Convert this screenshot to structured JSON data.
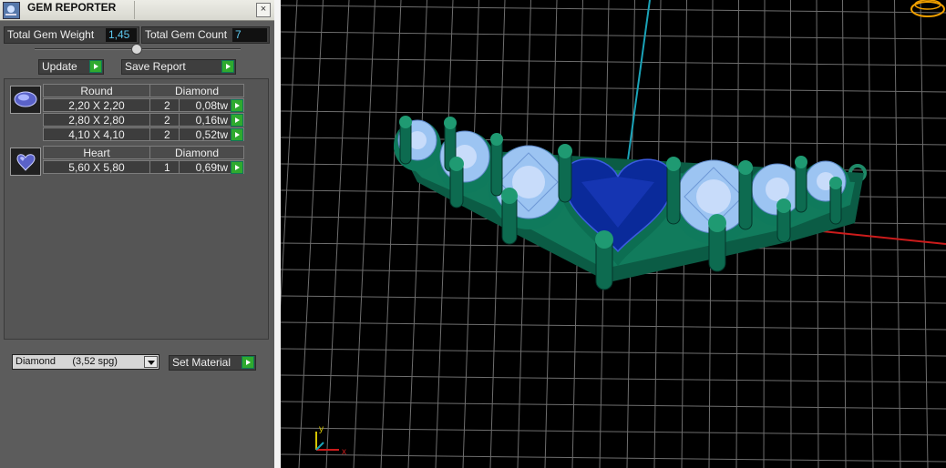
{
  "window": {
    "title": "GEM REPORTER",
    "close": "×"
  },
  "stats": {
    "total_weight_label": "Total Gem Weight",
    "total_weight_value": "1,45",
    "total_count_label": "Total Gem Count",
    "total_count_value": "7"
  },
  "toolbar": {
    "update_label": "Update",
    "save_report_label": "Save Report"
  },
  "gem_groups": [
    {
      "shape": "Round",
      "material": "Diamond",
      "thumb_icon": "round-gem-icon",
      "rows": [
        {
          "size": "2,20 X 2,20",
          "qty": "2",
          "weight": "0,08tw"
        },
        {
          "size": "2,80 X 2,80",
          "qty": "2",
          "weight": "0,16tw"
        },
        {
          "size": "4,10 X 4,10",
          "qty": "2",
          "weight": "0,52tw"
        }
      ]
    },
    {
      "shape": "Heart",
      "material": "Diamond",
      "thumb_icon": "heart-gem-icon",
      "rows": [
        {
          "size": "5,60 X 5,80",
          "qty": "1",
          "weight": "0,69tw"
        }
      ]
    }
  ],
  "material_select": {
    "value": "Diamond      (3,52 spg)",
    "set_label": "Set Material"
  },
  "viewport": {
    "axis_labels": {
      "y": "y",
      "x": "x"
    }
  },
  "colors": {
    "accent_green": "#2faa2f",
    "value_cyan": "#5ec9ef",
    "gem_blue": "#9cc4f2",
    "setting_green": "#10785a",
    "heart_blue": "#0a2a9a"
  }
}
